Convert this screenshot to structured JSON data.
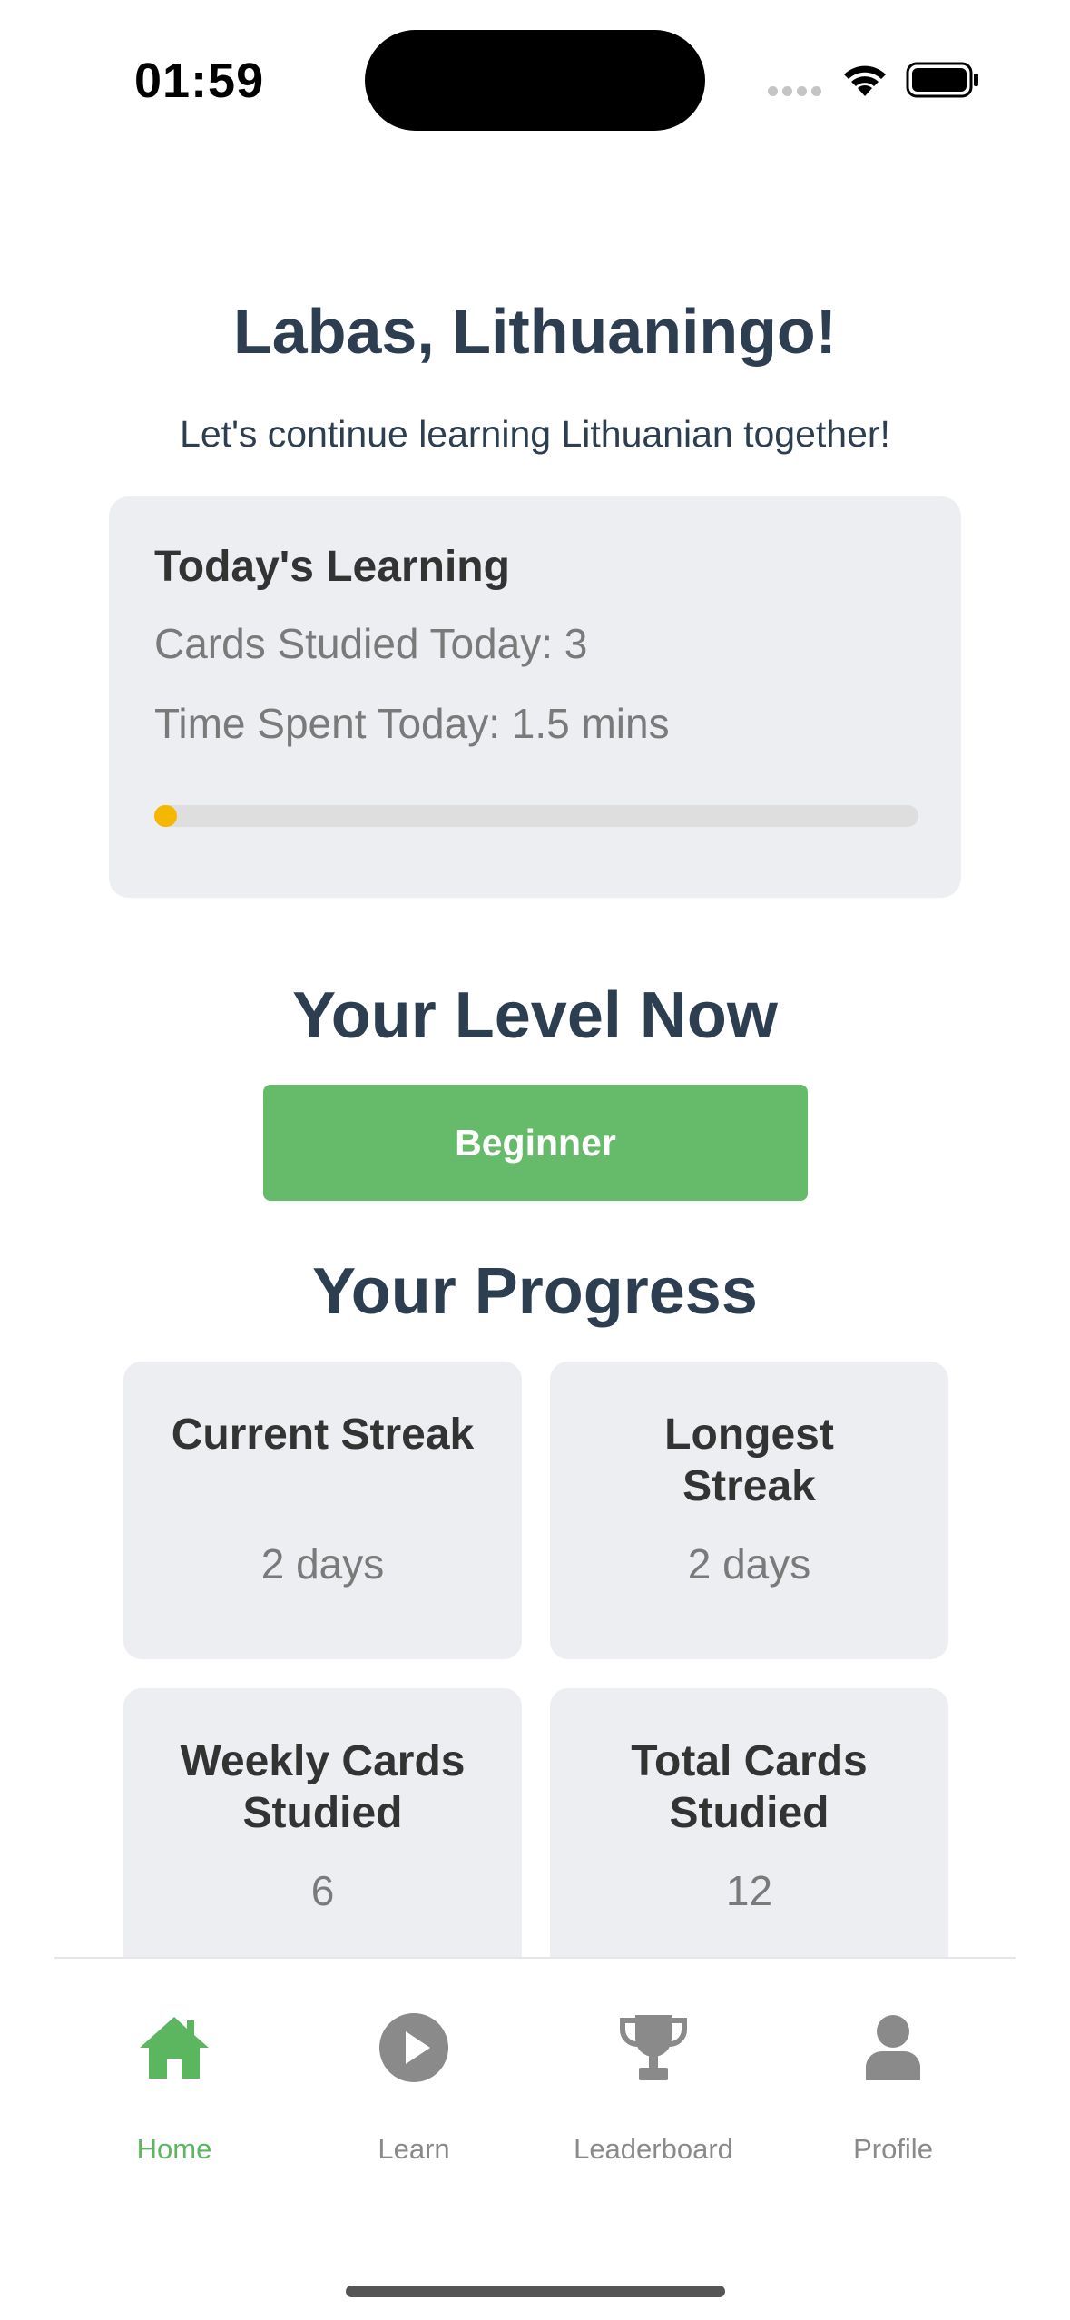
{
  "status_bar": {
    "time": "01:59"
  },
  "header": {
    "greeting": "Labas, Lithuaningo!",
    "subtitle": "Let's continue learning Lithuanian together!"
  },
  "today": {
    "title": "Today's Learning",
    "cards_studied": "Cards Studied Today: 3",
    "time_spent": "Time Spent Today: 1.5 mins",
    "progress_fraction": 0.03,
    "progress_color": "#f5b800"
  },
  "level": {
    "title": "Your Level Now",
    "value": "Beginner",
    "color": "#66bb6a"
  },
  "progress": {
    "title": "Your Progress",
    "stats": [
      {
        "label": "Current Streak",
        "value": "2 days"
      },
      {
        "label": "Longest Streak",
        "value": "2 days"
      },
      {
        "label": "Weekly Cards Studied",
        "value": "6"
      },
      {
        "label": "Total Cards Studied",
        "value": "12"
      }
    ]
  },
  "tabs": [
    {
      "label": "Home",
      "icon": "home-icon",
      "active": true
    },
    {
      "label": "Learn",
      "icon": "play-circle-icon",
      "active": false
    },
    {
      "label": "Leaderboard",
      "icon": "trophy-icon",
      "active": false
    },
    {
      "label": "Profile",
      "icon": "user-icon",
      "active": false
    }
  ],
  "colors": {
    "accent": "#5cb660",
    "card_bg": "#eceef1",
    "heading": "#2c3e50",
    "muted": "#7a7a7a"
  }
}
